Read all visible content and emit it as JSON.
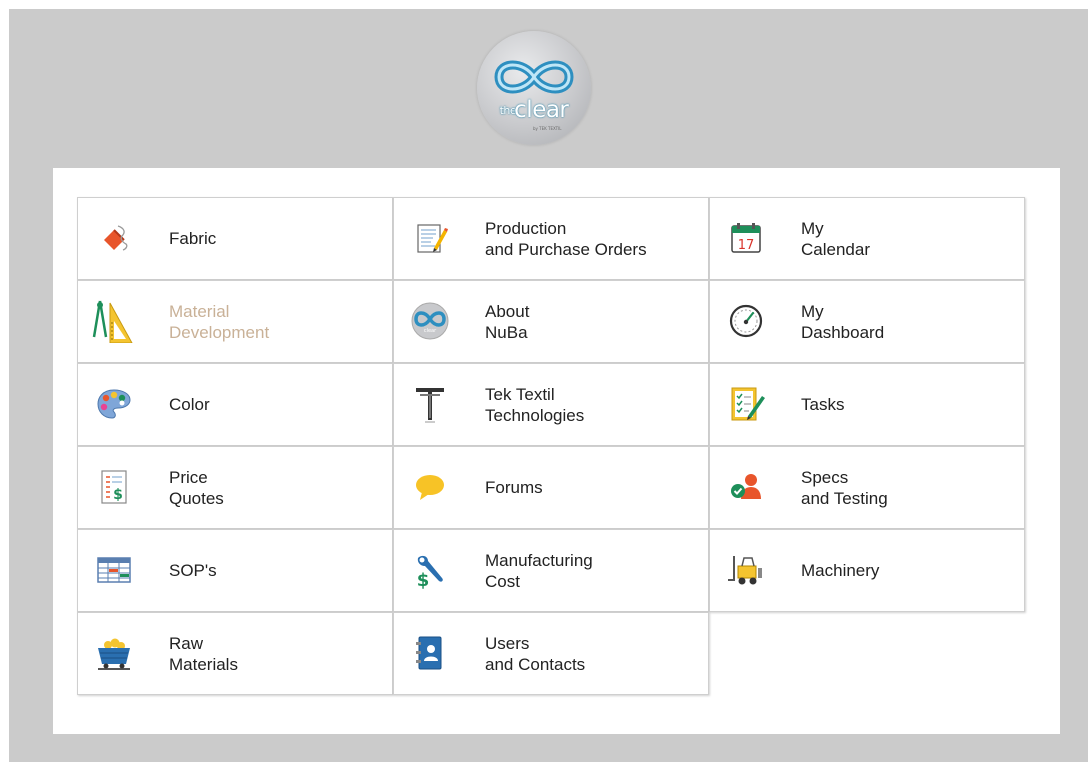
{
  "logo": {
    "brand": "clear",
    "prefix": "the",
    "tagline": "by TEK TEXTIL"
  },
  "modules": [
    {
      "label": "Fabric",
      "icon": "fabric-icon",
      "disabled": false
    },
    {
      "label": "Production\nand Purchase Orders",
      "icon": "notepad-pencil-icon",
      "disabled": false
    },
    {
      "label": "My\nCalendar",
      "icon": "calendar-icon",
      "icon_text": "17",
      "disabled": false
    },
    {
      "label": "Material\nDevelopment",
      "icon": "drafting-tools-icon",
      "disabled": true
    },
    {
      "label": "About\nNuBa",
      "icon": "infinity-logo-icon",
      "disabled": false
    },
    {
      "label": "My\nDashboard",
      "icon": "speedometer-icon",
      "disabled": false
    },
    {
      "label": "Color",
      "icon": "palette-icon",
      "disabled": false
    },
    {
      "label": "Tek Textil\nTechnologies",
      "icon": "tek-textil-logo-icon",
      "disabled": false
    },
    {
      "label": "Tasks",
      "icon": "checklist-pencil-icon",
      "disabled": false
    },
    {
      "label": "Price\nQuotes",
      "icon": "price-list-icon",
      "disabled": false
    },
    {
      "label": "Forums",
      "icon": "speech-bubble-icon",
      "disabled": false
    },
    {
      "label": "Specs\nand Testing",
      "icon": "user-check-icon",
      "disabled": false
    },
    {
      "label": "SOP's",
      "icon": "spreadsheet-icon",
      "disabled": false
    },
    {
      "label": "Manufacturing\nCost",
      "icon": "wrench-dollar-icon",
      "disabled": false
    },
    {
      "label": "Machinery",
      "icon": "forklift-icon",
      "disabled": false
    },
    {
      "label": "Raw\nMaterials",
      "icon": "mine-cart-icon",
      "disabled": false
    },
    {
      "label": "Users\nand Contacts",
      "icon": "address-book-icon",
      "disabled": false
    }
  ]
}
